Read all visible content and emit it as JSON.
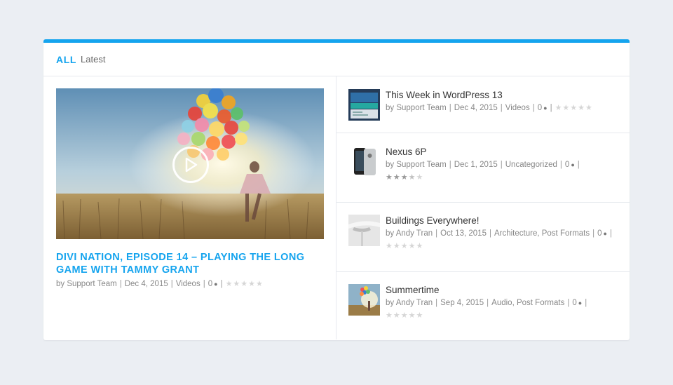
{
  "header": {
    "all_label": "ALL",
    "latest_label": "Latest"
  },
  "featured": {
    "title": "DIVI NATION, EPISODE 14 – PLAYING THE LONG GAME WITH TAMMY GRANT",
    "by": "by Support Team",
    "date": "Dec 4, 2015",
    "category": "Videos",
    "comments": "0",
    "rating": 0
  },
  "posts": [
    {
      "title": "This Week in WordPress 13",
      "meta": [
        "by Support Team",
        "Dec 4, 2015",
        "Videos"
      ],
      "comments": "0",
      "rating": 0,
      "thumb": "wordpress-thumb"
    },
    {
      "title": "Nexus 6P",
      "meta": [
        "by Support Team",
        "Dec 1, 2015",
        "Uncategorized"
      ],
      "comments": "0",
      "rating": 3.5,
      "thumb": "phone-thumb"
    },
    {
      "title": "Buildings Everywhere!",
      "meta": [
        "by Andy Tran",
        "Oct 13, 2015",
        "Architecture, Post Formats"
      ],
      "comments": "0",
      "rating": 0,
      "thumb": "building-thumb"
    },
    {
      "title": "Summertime",
      "meta": [
        "by Andy Tran",
        "Sep 4, 2015",
        "Audio, Post Formats"
      ],
      "comments": "0",
      "rating": 0,
      "thumb": "balloons-thumb"
    }
  ],
  "colors": {
    "accent": "#15a4ee",
    "meta": "#888888"
  }
}
